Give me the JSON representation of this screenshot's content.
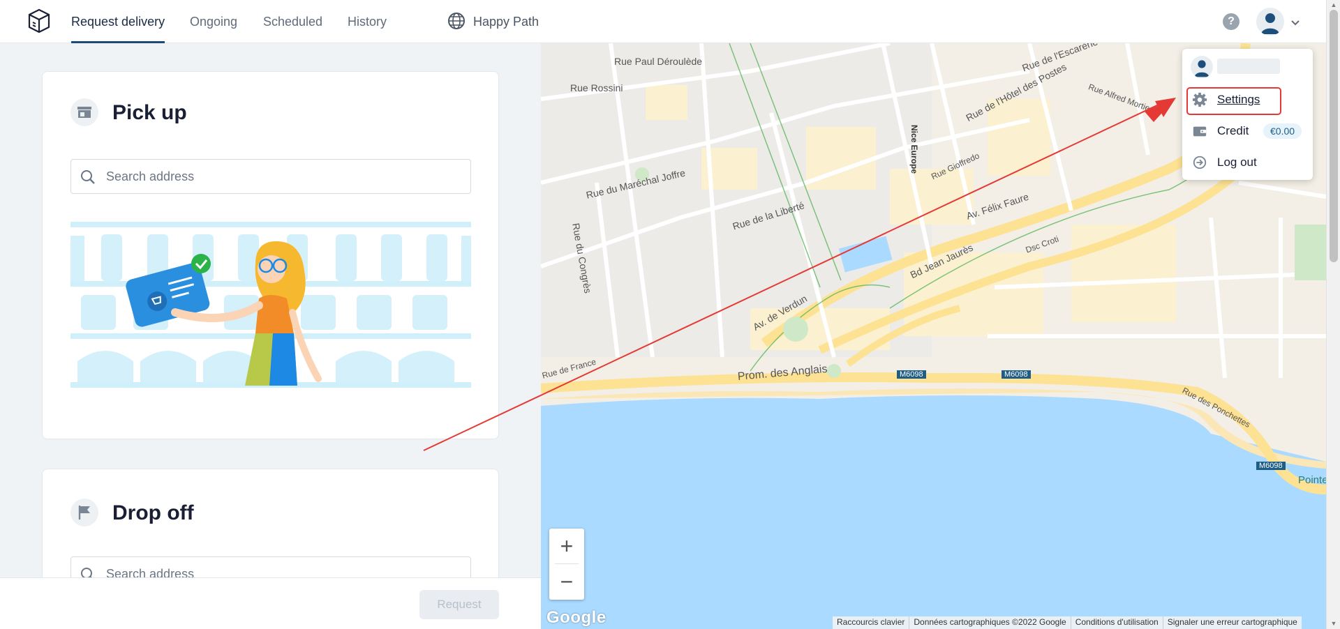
{
  "app": {
    "nav": {
      "tabs": [
        {
          "label": "Request delivery",
          "active": true
        },
        {
          "label": "Ongoing",
          "active": false
        },
        {
          "label": "Scheduled",
          "active": false
        },
        {
          "label": "History",
          "active": false
        }
      ],
      "workspace_name": "Happy Path",
      "help_symbol": "?"
    },
    "icons": {
      "logo": "box-logo-icon",
      "workspace": "globe-icon",
      "help": "help-icon",
      "avatar": "user-avatar-icon",
      "chevron": "chevron-down-icon"
    }
  },
  "pickup": {
    "title": "Pick up",
    "search_placeholder": "Search address",
    "icon": "store-icon"
  },
  "dropoff": {
    "title": "Drop off",
    "search_placeholder": "Search address",
    "icon": "flag-icon"
  },
  "footer": {
    "request_label": "Request",
    "request_enabled": false
  },
  "map": {
    "zoom_in": "+",
    "zoom_out": "−",
    "logo": "Google",
    "attribution": [
      "Raccourcis clavier",
      "Données cartographiques ©2022 Google",
      "Conditions d'utilisation",
      "Signaler une erreur cartographique"
    ],
    "labels": [
      "Rue Paul Déroulède",
      "Rue Rossini",
      "Rue du Maréchal Joffre",
      "Rue de la Liberté",
      "Av. Félix Faure",
      "Bd Jean Jaurès",
      "Av. de Verdun",
      "Prom. des Anglais",
      "Rue du Congrès",
      "Rue de France",
      "Rue de l'Escarène",
      "Rue Alfred Mortier",
      "Rue de l'Hôtel des Postes",
      "Rue des Ponchettes",
      "M6098",
      "Nice Europe",
      "Rue Gioffredo",
      "Dsc Croti",
      "Pointe Rauba"
    ],
    "colors": {
      "sea": "#aadaff",
      "land": "#f5f1e6",
      "roads": "#ffffff",
      "major_roads": "#fde293",
      "park": "#cfe8c8"
    }
  },
  "user_menu": {
    "items": [
      {
        "label": "Settings",
        "icon": "gear-icon",
        "highlighted": true
      },
      {
        "label": "Credit",
        "icon": "wallet-icon",
        "badge": "€0.00"
      },
      {
        "label": "Log out",
        "icon": "logout-icon"
      }
    ]
  },
  "annotation": {
    "type": "arrow",
    "color": "#e53935",
    "target": "Settings"
  },
  "colors": {
    "accent": "#1e4a7a",
    "highlight": "#e53935",
    "panel_bg": "#f0f3f6",
    "badge_bg": "#e6f3fb"
  }
}
